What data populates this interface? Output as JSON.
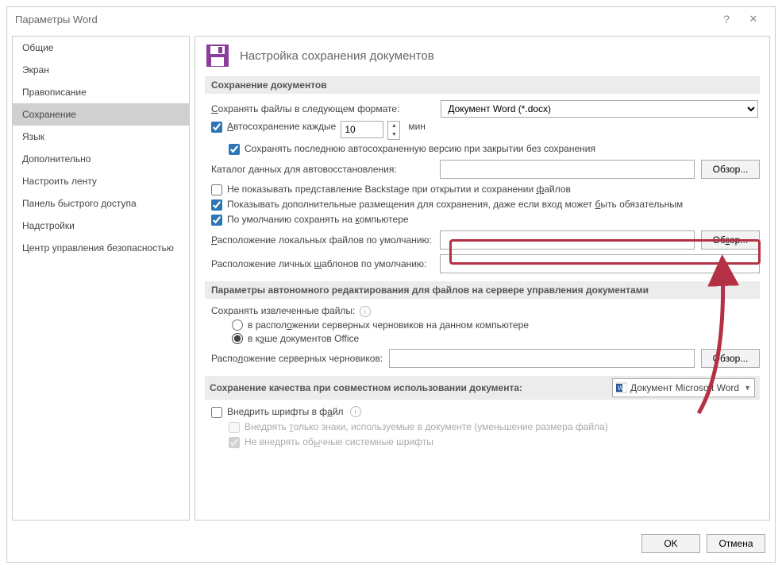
{
  "title": "Параметры Word",
  "sidebar": {
    "items": [
      {
        "label": "Общие"
      },
      {
        "label": "Экран"
      },
      {
        "label": "Правописание"
      },
      {
        "label": "Сохранение"
      },
      {
        "label": "Язык"
      },
      {
        "label": "Дополнительно"
      },
      {
        "label": "Настроить ленту"
      },
      {
        "label": "Панель быстрого доступа"
      },
      {
        "label": "Надстройки"
      },
      {
        "label": "Центр управления безопасностью"
      }
    ],
    "selected_index": 3
  },
  "header": "Настройка сохранения документов",
  "sections": {
    "save_docs": {
      "title": "Сохранение документов",
      "format_label": "Сохранять файлы в следующем формате:",
      "format_value": "Документ Word (*.docx)",
      "autosave_label": "Автосохранение каждые",
      "autosave_value": "10",
      "autosave_unit": "мин",
      "keep_last": "Сохранять последнюю автосохраненную версию при закрытии без сохранения",
      "autorecover_label": "Каталог данных для автовосстановления:",
      "browse": "Обзор...",
      "no_backstage": "Не показывать представление Backstage при открытии и сохранении файлов",
      "show_extra": "Показывать дополнительные размещения для сохранения, даже если вход может быть обязательным",
      "default_pc": "По умолчанию сохранять на компьютере",
      "local_loc_label": "Расположение локальных файлов по умолчанию:",
      "templates_loc_label": "Расположение личных шаблонов по умолчанию:"
    },
    "offline": {
      "title": "Параметры автономного редактирования для файлов на сервере управления документами",
      "save_extracted": "Сохранять извлеченные файлы:",
      "opt_drafts": "в расположении серверных черновиков на данном компьютере",
      "opt_cache": "в кэше документов Office",
      "drafts_loc_label": "Расположение серверных черновиков:"
    },
    "quality": {
      "title": "Сохранение качества при совместном использовании документа:",
      "doc_name": "Документ Microsoft Word",
      "embed_fonts": "Внедрить шрифты в файл",
      "embed_only_used": "Внедрять только знаки, используемые в документе (уменьшение размера файла)",
      "no_system_fonts": "Не внедрять обычные системные шрифты"
    }
  },
  "footer": {
    "ok": "OK",
    "cancel": "Отмена"
  }
}
